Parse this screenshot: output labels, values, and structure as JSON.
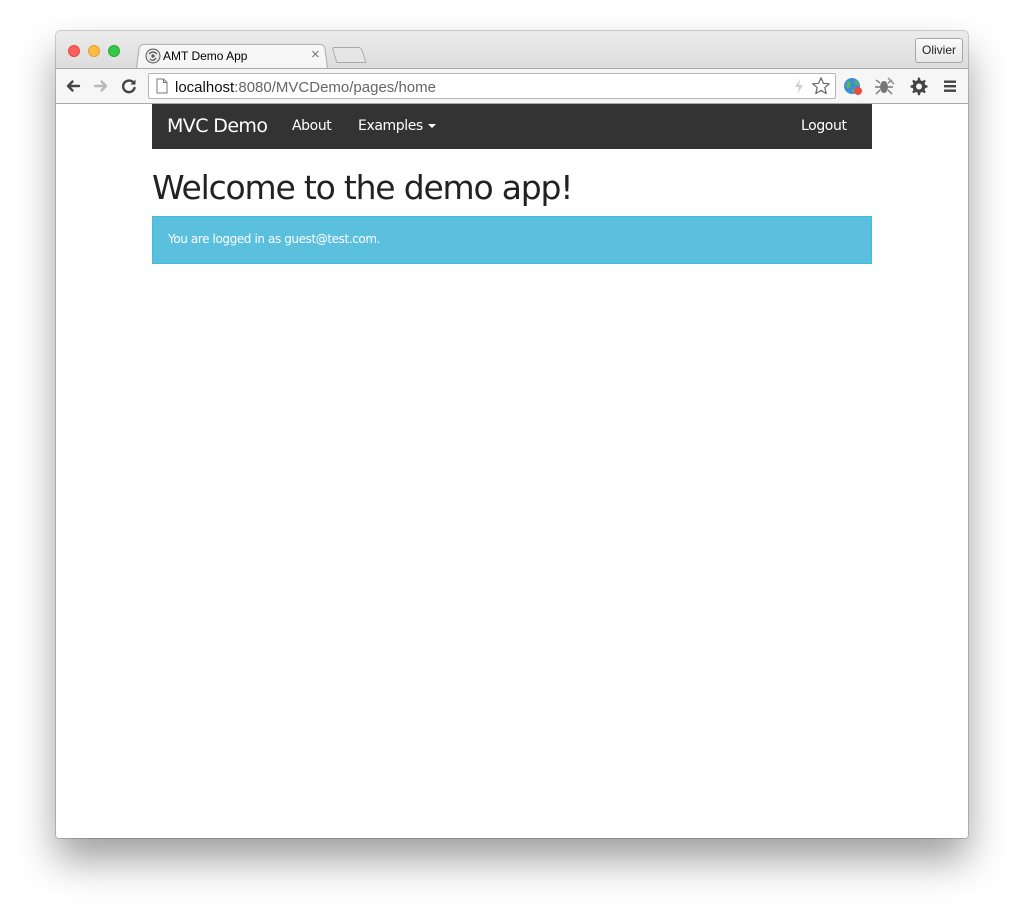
{
  "browser": {
    "tab": {
      "title": "AMT Demo App",
      "close_glyph": "×"
    },
    "profile_name": "Olivier",
    "url": {
      "host": "localhost",
      "rest": ":8080/MVCDemo/pages/home"
    },
    "icons": [
      "back-icon",
      "forward-icon",
      "reload-icon",
      "page-icon",
      "lightning-icon",
      "star-icon",
      "globe-extension-icon",
      "bug-extension-icon",
      "gear-icon",
      "menu-icon"
    ]
  },
  "navbar": {
    "brand": "MVC Demo",
    "about": "About",
    "examples": "Examples",
    "logout": "Logout"
  },
  "main": {
    "heading": "Welcome to the demo app!",
    "alert": "You are logged in as guest@test.com."
  },
  "colors": {
    "navbar_bg": "#333333",
    "alert_bg": "#5bc0de",
    "alert_border": "#46b8da"
  }
}
